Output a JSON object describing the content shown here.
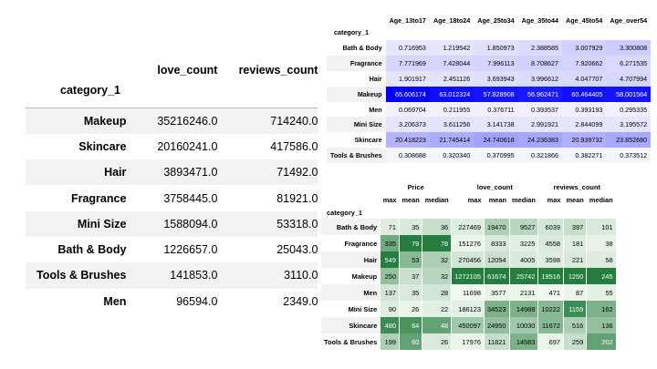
{
  "left_table": {
    "columns": [
      "love_count",
      "reviews_count"
    ],
    "index_name": "category_1",
    "rows": [
      {
        "label": "Makeup",
        "love_count": "35216246.0",
        "reviews_count": "714240.0"
      },
      {
        "label": "Skincare",
        "love_count": "20160241.0",
        "reviews_count": "417586.0"
      },
      {
        "label": "Hair",
        "love_count": "3893471.0",
        "reviews_count": "71492.0"
      },
      {
        "label": "Fragrance",
        "love_count": "3758445.0",
        "reviews_count": "81921.0"
      },
      {
        "label": "Mini Size",
        "love_count": "1588094.0",
        "reviews_count": "53318.0"
      },
      {
        "label": "Bath & Body",
        "love_count": "1226657.0",
        "reviews_count": "25043.0"
      },
      {
        "label": "Tools & Brushes",
        "love_count": "141853.0",
        "reviews_count": "3110.0"
      },
      {
        "label": "Men",
        "love_count": "96594.0",
        "reviews_count": "2349.0"
      }
    ]
  },
  "age_table": {
    "columns": [
      "Age_13to17",
      "Age_18to24",
      "Age_25to34",
      "Age_35to44",
      "Age_45to54",
      "Age_over54"
    ],
    "index_name": "category_1",
    "rows": [
      {
        "label": "Bath & Body",
        "values": [
          "0.716953",
          "1.219542",
          "1.850973",
          "2.388585",
          "3.007929",
          "3.300808"
        ],
        "shade": [
          0.1,
          0.1,
          0.12,
          0.14,
          0.18,
          0.2
        ]
      },
      {
        "label": "Fragrance",
        "values": [
          "7.771969",
          "7.428044",
          "7.996113",
          "8.708627",
          "7.920662",
          "6.271535"
        ],
        "shade": [
          0.16,
          0.16,
          0.17,
          0.18,
          0.17,
          0.15
        ]
      },
      {
        "label": "Hair",
        "values": [
          "1.901917",
          "2.451126",
          "3.693943",
          "3.996612",
          "4.047707",
          "4.707994"
        ],
        "shade": [
          0.1,
          0.11,
          0.13,
          0.14,
          0.15,
          0.16
        ]
      },
      {
        "label": "Makeup",
        "values": [
          "65.606174",
          "63.012324",
          "57.828908",
          "56.962471",
          "60.464405",
          "58.001564"
        ],
        "shade": [
          1.0,
          0.95,
          0.92,
          0.9,
          0.94,
          0.92
        ]
      },
      {
        "label": "Men",
        "values": [
          "0.069704",
          "0.211955",
          "0.376711",
          "0.393537",
          "0.393193",
          "0.295335"
        ],
        "shade": [
          0.05,
          0.05,
          0.06,
          0.06,
          0.06,
          0.06
        ]
      },
      {
        "label": "Mini Size",
        "values": [
          "3.206373",
          "3.611256",
          "3.141738",
          "2.991921",
          "2.844099",
          "3.195572"
        ],
        "shade": [
          0.1,
          0.11,
          0.1,
          0.1,
          0.1,
          0.1
        ]
      },
      {
        "label": "Skincare",
        "values": [
          "20.418223",
          "21.745414",
          "24.740618",
          "24.236383",
          "20.939732",
          "23.852680"
        ],
        "shade": [
          0.3,
          0.32,
          0.36,
          0.35,
          0.31,
          0.34
        ]
      },
      {
        "label": "Tools & Brushes",
        "values": [
          "0.308688",
          "0.320340",
          "0.370995",
          "0.321866",
          "0.382271",
          "0.373512"
        ],
        "shade": [
          0.04,
          0.04,
          0.04,
          0.04,
          0.04,
          0.04
        ]
      }
    ],
    "colors": {
      "low": "#ffffff",
      "high": "#0000ff",
      "light_text": "#ffffff"
    }
  },
  "metric_table": {
    "groups": [
      "Price",
      "love_count",
      "reviews_count"
    ],
    "subcolumns": [
      "max",
      "mean",
      "median"
    ],
    "index_name": "category_1",
    "rows": [
      {
        "label": "Bath & Body",
        "values": [
          "71",
          "35",
          "36",
          "227469",
          "19470",
          "9527",
          "6039",
          "397",
          "101"
        ],
        "shade": [
          0.1,
          0.12,
          0.2,
          0.1,
          0.3,
          0.25,
          0.15,
          0.2,
          0.12
        ]
      },
      {
        "label": "Fragrance",
        "values": [
          "335",
          "79",
          "78",
          "151276",
          "8333",
          "3225",
          "4558",
          "181",
          "38"
        ],
        "shade": [
          0.55,
          0.85,
          0.85,
          0.05,
          0.12,
          0.08,
          0.12,
          0.1,
          0.06
        ]
      },
      {
        "label": "Hair",
        "values": [
          "549",
          "53",
          "32",
          "270456",
          "12054",
          "4005",
          "3598",
          "221",
          "58"
        ],
        "shade": [
          0.85,
          0.45,
          0.3,
          0.15,
          0.18,
          0.12,
          0.1,
          0.12,
          0.1
        ]
      },
      {
        "label": "Makeup",
        "values": [
          "250",
          "37",
          "32",
          "1272105",
          "61674",
          "25742",
          "19516",
          "1250",
          "245"
        ],
        "shade": [
          0.4,
          0.18,
          0.25,
          0.85,
          0.85,
          0.85,
          0.85,
          0.85,
          0.85
        ]
      },
      {
        "label": "Men",
        "values": [
          "137",
          "35",
          "28",
          "11698",
          "3577",
          "2131",
          "471",
          "87",
          "55"
        ],
        "shade": [
          0.15,
          0.12,
          0.15,
          0.03,
          0.05,
          0.05,
          0.03,
          0.05,
          0.08
        ]
      },
      {
        "label": "Mini Size",
        "values": [
          "90",
          "26",
          "22",
          "186123",
          "34523",
          "14988",
          "10222",
          "1159",
          "162"
        ],
        "shade": [
          0.1,
          0.05,
          0.08,
          0.08,
          0.5,
          0.5,
          0.45,
          0.75,
          0.5
        ]
      },
      {
        "label": "Skincare",
        "values": [
          "480",
          "64",
          "48",
          "450097",
          "24950",
          "10030",
          "11672",
          "516",
          "136"
        ],
        "shade": [
          0.75,
          0.7,
          0.6,
          0.35,
          0.4,
          0.35,
          0.45,
          0.3,
          0.4
        ]
      },
      {
        "label": "Tools & Brushes",
        "values": [
          "199",
          "60",
          "26",
          "17976",
          "11821",
          "14583",
          "697",
          "259",
          "202"
        ],
        "shade": [
          0.3,
          0.6,
          0.12,
          0.05,
          0.2,
          0.5,
          0.05,
          0.2,
          0.6
        ]
      }
    ],
    "colors": {
      "low": "#f7fcf5",
      "high": "#00661f",
      "light_text": "#ffffff"
    }
  }
}
